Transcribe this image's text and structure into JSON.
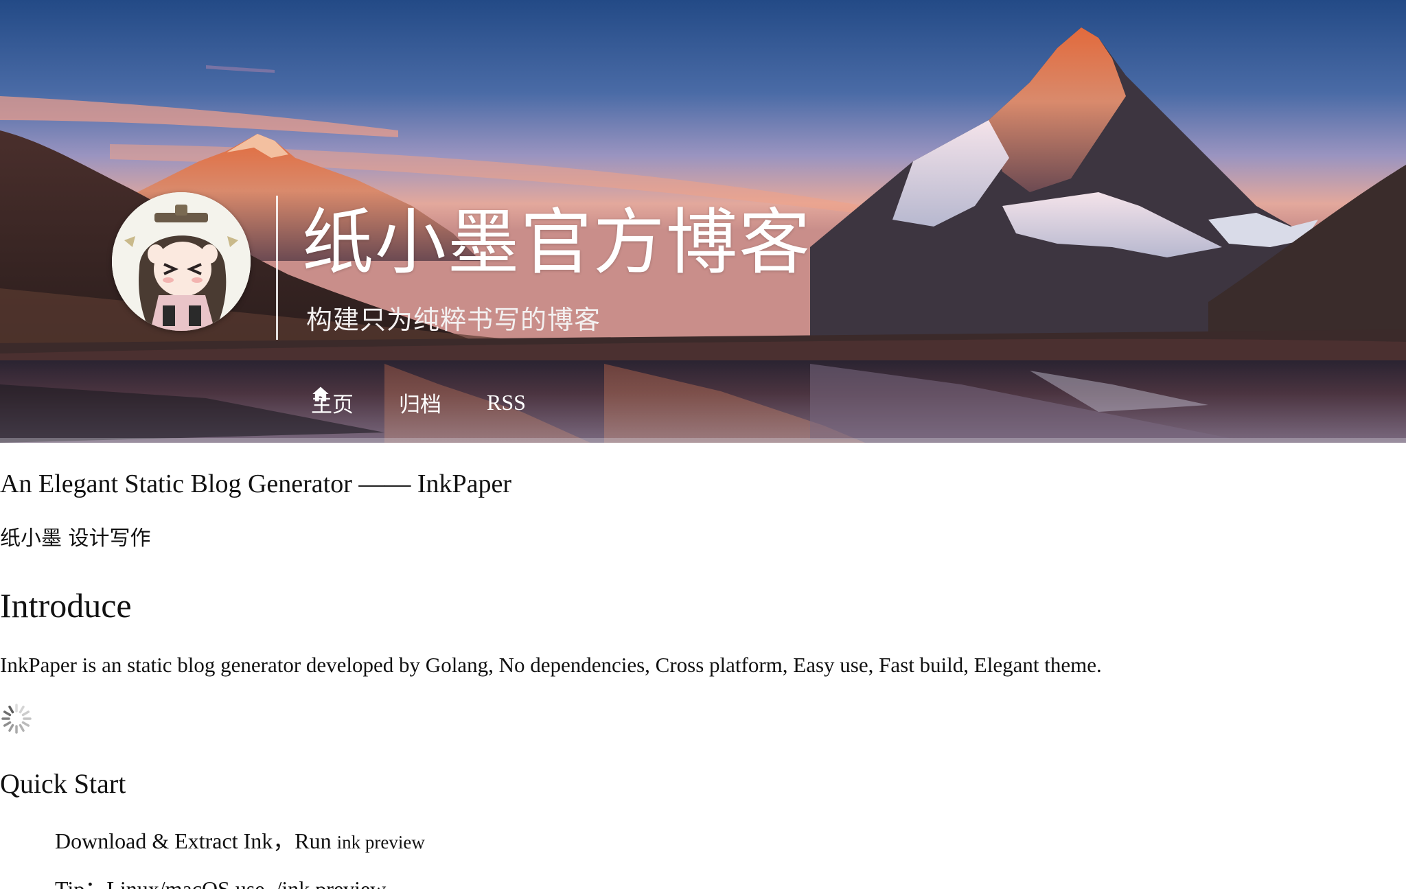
{
  "header": {
    "site_title": "纸小墨官方博客",
    "site_subtitle": "构建只为纯粹书写的博客",
    "nav": [
      {
        "label": "主页",
        "icon": "home-icon"
      },
      {
        "label": "归档"
      },
      {
        "label": "RSS"
      }
    ]
  },
  "post": {
    "title": "An Elegant Static Blog Generator —— InkPaper",
    "meta": "纸小墨 设计写作",
    "introduce_heading": "Introduce",
    "introduce_text": "InkPaper is an static blog generator developed by Golang, No dependencies, Cross platform, Easy use, Fast build, Elegant theme.",
    "quick_start_heading": "Quick Start",
    "steps": [
      {
        "text": "Download & Extract Ink，Run ",
        "code": "ink preview"
      },
      {
        "text": "Tip：Linux/macOS use ./ink preview"
      }
    ]
  },
  "colors": {
    "text": "#111111",
    "nav_text": "#ffffff",
    "sky_top": "#2e4f8a",
    "sunset": "#e89a86"
  }
}
